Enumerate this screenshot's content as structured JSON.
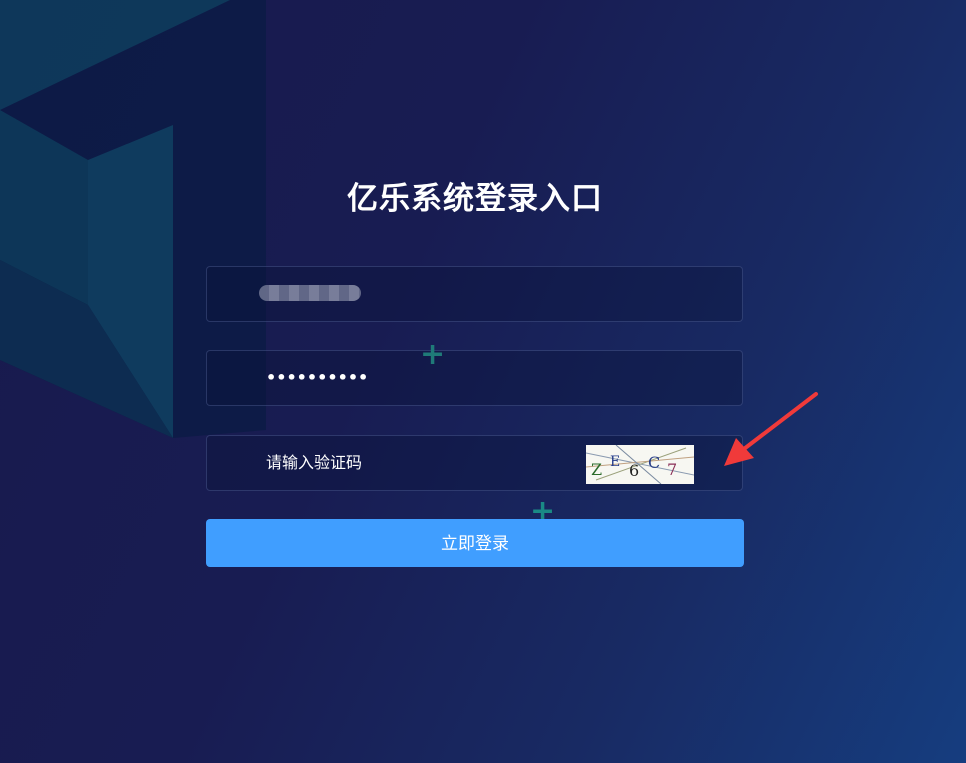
{
  "login": {
    "title": "亿乐系统登录入口",
    "username_masked": true,
    "password_value": "••••••••••",
    "captcha_placeholder": "请输入验证码",
    "captcha_chars": [
      "Z",
      "E",
      "6",
      "C",
      "7"
    ],
    "submit_label": "立即登录"
  },
  "colors": {
    "primary_button": "#409eff",
    "background_start": "#181a4d",
    "background_end": "#163d7f",
    "arrow": "#f03a3a"
  },
  "icons": {
    "decor_plus_1": "plus-icon",
    "decor_plus_2": "plus-icon",
    "annotation_arrow": "red-arrow-icon"
  }
}
